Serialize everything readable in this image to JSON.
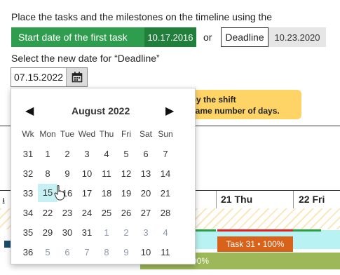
{
  "instructions": {
    "line1": "Place the tasks and the milestones on the timeline using the",
    "start_label": "Start date of the first task",
    "start_value": "10.17.2016",
    "or_text": "or",
    "deadline_label": "Deadline",
    "deadline_value": "10.23.2020",
    "select_label": "Select the new date for “Deadline”"
  },
  "date_input": {
    "value": "07.15.2022"
  },
  "tooltip": {
    "line1": "d by the shift",
    "line2": "e same number of days."
  },
  "gantt": {
    "col_thu": "21 Thu",
    "col_fri": "22 Fri",
    "task_label": "Task 31 • 100%",
    "progress_label": "00%"
  },
  "calendar": {
    "month_label": "August 2022",
    "headers": [
      "Wk",
      "Mon",
      "Tue",
      "Wed",
      "Thu",
      "Fri",
      "Sat",
      "Sun"
    ],
    "weeks": [
      {
        "wk": "31",
        "days": [
          "1",
          "2",
          "3",
          "4",
          "5",
          "6",
          "7"
        ]
      },
      {
        "wk": "32",
        "days": [
          "8",
          "9",
          "10",
          "11",
          "12",
          "13",
          "14"
        ]
      },
      {
        "wk": "33",
        "days": [
          "15",
          "16",
          "17",
          "18",
          "19",
          "20",
          "21"
        ]
      },
      {
        "wk": "34",
        "days": [
          "22",
          "23",
          "24",
          "25",
          "26",
          "27",
          "28"
        ]
      },
      {
        "wk": "35",
        "days": [
          "29",
          "30",
          "31",
          "1",
          "2",
          "3",
          "4"
        ]
      },
      {
        "wk": "36",
        "days": [
          "5",
          "6",
          "7",
          "8",
          "9",
          "10",
          "11"
        ]
      }
    ],
    "selected_day": "15",
    "colors": {
      "selected_bg": "#c6f0f3",
      "other_month": "#8f98a8"
    }
  }
}
